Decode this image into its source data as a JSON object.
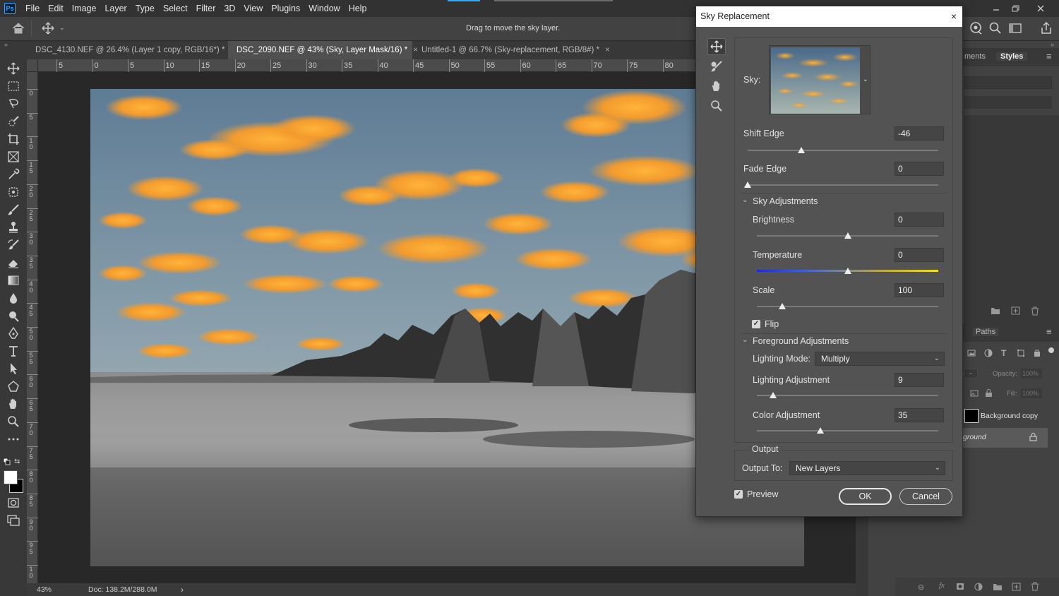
{
  "app": {
    "logo": "Ps"
  },
  "menu": [
    "File",
    "Edit",
    "Image",
    "Layer",
    "Type",
    "Select",
    "Filter",
    "3D",
    "View",
    "Plugins",
    "Window",
    "Help"
  ],
  "options_bar": {
    "hint": "Drag to move the sky layer."
  },
  "tabs": [
    {
      "label": "DSC_4130.NEF @ 26.4% (Layer 1 copy, RGB/16*) *",
      "active": false
    },
    {
      "label": "DSC_2090.NEF @ 43% (Sky, Layer Mask/16) *",
      "active": true
    },
    {
      "label": "Untitled-1 @ 66.7% (Sky-replacement, RGB/8#) *",
      "active": false
    }
  ],
  "ruler_top": [
    "5",
    "0",
    "5",
    "10",
    "15",
    "20",
    "25",
    "30",
    "35",
    "40",
    "45",
    "50",
    "55",
    "60",
    "65",
    "70",
    "75",
    "80"
  ],
  "ruler_left": [
    "0",
    "5",
    "10",
    "15",
    "20",
    "25",
    "30",
    "35",
    "40",
    "45",
    "50",
    "55",
    "60",
    "65",
    "70",
    "75",
    "80",
    "85",
    "90",
    "95",
    "10"
  ],
  "status": {
    "zoom": "43%",
    "doc": "Doc: 138.2M/288.0M",
    "arrow": "›"
  },
  "dialog": {
    "title": "Sky Replacement",
    "close": "×",
    "sky_label": "Sky:",
    "shift_edge": {
      "label": "Shift Edge",
      "value": "-46",
      "fraction": 0.28
    },
    "fade_edge": {
      "label": "Fade Edge",
      "value": "0",
      "fraction": 0.0
    },
    "sky_adjustments": {
      "header": "Sky Adjustments",
      "brightness": {
        "label": "Brightness",
        "value": "0",
        "fraction": 0.5
      },
      "temperature": {
        "label": "Temperature",
        "value": "0",
        "fraction": 0.5
      },
      "scale": {
        "label": "Scale",
        "value": "100",
        "fraction": 0.14
      },
      "flip": {
        "label": "Flip",
        "checked": true
      }
    },
    "foreground_adjustments": {
      "header": "Foreground Adjustments",
      "lighting_mode": {
        "label": "Lighting Mode:",
        "value": "Multiply"
      },
      "lighting_adjustment": {
        "label": "Lighting Adjustment",
        "value": "9",
        "fraction": 0.09
      },
      "color_adjustment": {
        "label": "Color Adjustment",
        "value": "35",
        "fraction": 0.35
      }
    },
    "output": {
      "header": "Output",
      "label": "Output To:",
      "value": "New Layers"
    },
    "preview": {
      "label": "Preview",
      "checked": true
    },
    "ok": "OK",
    "cancel": "Cancel"
  },
  "right_panel": {
    "tab_adjustments": "ments",
    "tab_styles": "Styles",
    "tab_paths": "Paths",
    "opacity_label": "Opacity:",
    "opacity_value": "100%",
    "fill_label": "Fill:",
    "fill_value": "100%",
    "layers": [
      {
        "name": "Background copy",
        "selected": false
      },
      {
        "name": "ground",
        "selected": true
      }
    ]
  },
  "colors": {
    "accent": "#31a8ff",
    "dialog_bg": "#535353",
    "ui_dark": "#323232"
  }
}
